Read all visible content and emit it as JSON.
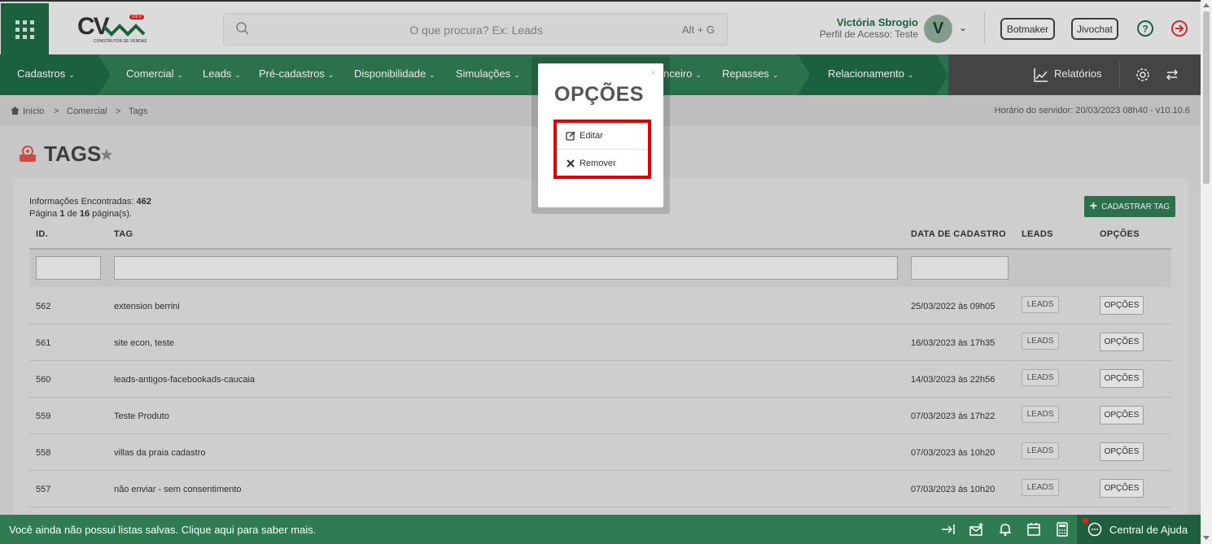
{
  "header": {
    "search_placeholder": "O que procura? Ex: Leads",
    "search_shortcut": "Alt + G",
    "logo_text": "CV",
    "logo_badge": "DEV",
    "logo_sub": "CONSTRUTOR DE VENDAS",
    "user_name": "Victória Sbrogio",
    "user_profile": "Perfil de Acesso: Teste",
    "avatar_initial": "V",
    "botmaker": "Botmaker",
    "jivochat": "Jivochat"
  },
  "nav": {
    "items": [
      {
        "label": "Cadastros"
      },
      {
        "label": "Comercial"
      },
      {
        "label": "Leads"
      },
      {
        "label": "Pré-cadastros"
      },
      {
        "label": "Disponibilidade"
      },
      {
        "label": "Simulações"
      },
      {
        "label": "nceiro"
      },
      {
        "label": "Repasses"
      },
      {
        "label": "Relacionamento"
      }
    ],
    "reports": "Relatórios"
  },
  "breadcrumb": {
    "home": "Início",
    "sep": ">",
    "comercial": "Comercial",
    "tags": "Tags",
    "server_time": "Horário do servidor: 20/03/2023 08h40 - v10.10.6"
  },
  "page": {
    "title": "TAGS",
    "info_found_label": "Informações Encontradas:",
    "info_found_value": "462",
    "page_label_1": "Página",
    "page_current": "1",
    "page_label_2": "de",
    "page_total": "16",
    "page_label_3": "página(s).",
    "add_button": "CADASTRAR TAG"
  },
  "table": {
    "headers": {
      "id": "ID.",
      "tag": "TAG",
      "date": "DATA DE CADASTRO",
      "leads": "LEADS",
      "options": "OPÇÕES"
    },
    "leads_btn": "LEADS",
    "options_btn": "OPÇÕES",
    "rows": [
      {
        "id": "562",
        "tag": "extension berrini",
        "date": "25/03/2022 às 09h05"
      },
      {
        "id": "561",
        "tag": "site econ, teste",
        "date": "16/03/2023 às 17h35"
      },
      {
        "id": "560",
        "tag": "leads-antigos-facebookads-caucaia",
        "date": "14/03/2023 às 22h56"
      },
      {
        "id": "559",
        "tag": "Teste Produto",
        "date": "07/03/2023 às 17h22"
      },
      {
        "id": "558",
        "tag": "villas da praia cadastro",
        "date": "07/03/2023 às 10h20"
      },
      {
        "id": "557",
        "tag": "não enviar - sem consentimento",
        "date": "07/03/2023 às 10h20"
      }
    ]
  },
  "footer": {
    "message": "Você ainda não possui listas salvas. Clique aqui para saber mais.",
    "help": "Central de Ajuda"
  },
  "modal": {
    "title": "OPÇÕES",
    "close": "×",
    "options": [
      {
        "label": "Editar"
      },
      {
        "label": "Remover"
      }
    ]
  },
  "colors": {
    "brand_green": "#2f7b52",
    "brand_dark_green": "#1f6a45",
    "highlight_red": "#e00000"
  }
}
